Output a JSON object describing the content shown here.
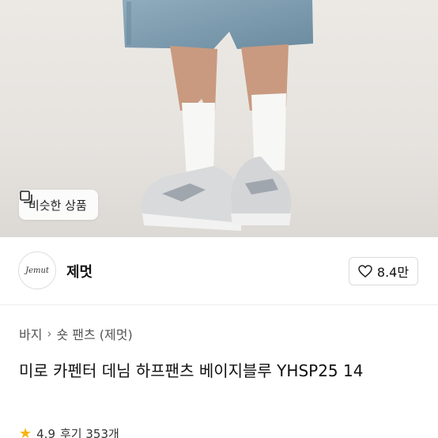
{
  "product_image": {
    "similar_button_label": "비슷한 상품"
  },
  "shop": {
    "logo_text": "Jemut",
    "name": "제멋",
    "likes": "8.4만"
  },
  "breadcrumb": {
    "category": "바지",
    "subcategory": "숏 팬츠 (제멋)"
  },
  "product": {
    "title": "미로 카펜터 데님 하프팬츠 베이지블루 YHSP25 14",
    "rating": "4.9",
    "reviews": "후기 353개"
  },
  "colors": {
    "star": "#f5b50a"
  }
}
